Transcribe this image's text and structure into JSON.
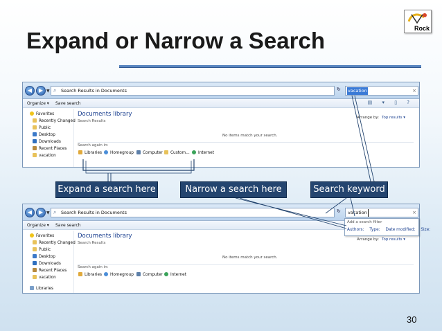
{
  "slide": {
    "title": "Expand or Narrow a Search",
    "logo_text": "Rock",
    "page_number": "30"
  },
  "callouts": {
    "expand": "Expand a search here",
    "narrow": "Narrow a search here",
    "keyword": "Search keyword"
  },
  "explorer": {
    "address": "Search Results in Documents",
    "toolbar": {
      "organize": "Organize ▾",
      "save_search": "Save search"
    },
    "favorites": [
      "Favorites",
      "Recently Changed",
      "Public",
      "Desktop",
      "Downloads",
      "Recent Places",
      "vacation"
    ],
    "libraries_label": "Libraries",
    "library_title": "Documents library",
    "library_subtitle": "Search Results",
    "arrange_label": "Arrange by:",
    "arrange_value": "Top results ▾",
    "empty_message": "No items match your search.",
    "search_again_label": "Search again in:",
    "search_again_items": [
      "Libraries",
      "Homegroup",
      "Computer",
      "Custom...",
      "Internet"
    ],
    "search_value_top": "vacation",
    "search_value_bottom": "vacation"
  },
  "filter_dropdown": {
    "header": "Add a search filter",
    "options": [
      "Authors:",
      "Type:",
      "Date modified:",
      "Size:"
    ]
  }
}
